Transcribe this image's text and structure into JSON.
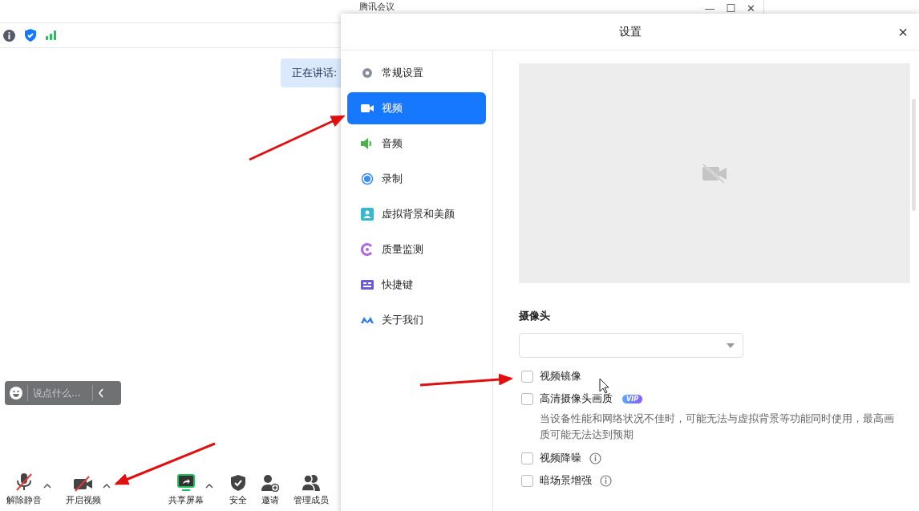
{
  "main_window": {
    "title": "腾讯会议",
    "window_controls": [
      "—",
      "☐",
      "✕"
    ],
    "speaking_label": "正在讲话:",
    "chat": {
      "placeholder": "说点什么..."
    },
    "toolbar": [
      {
        "kind": "mic",
        "label": "解除静音",
        "caret": true
      },
      {
        "kind": "camera",
        "label": "开启视频",
        "caret": true
      },
      {
        "kind": "share",
        "label": "共享屏幕",
        "caret": true
      },
      {
        "kind": "shield",
        "label": "安全",
        "caret": false
      },
      {
        "kind": "invite",
        "label": "邀请",
        "caret": false
      },
      {
        "kind": "members",
        "label": "管理成员",
        "caret": false
      }
    ]
  },
  "settings_dialog": {
    "title": "设置",
    "close": "×",
    "sidebar": [
      {
        "kind": "gear",
        "label": "常规设置",
        "selected": false
      },
      {
        "kind": "video",
        "label": "视频",
        "selected": true
      },
      {
        "kind": "audio",
        "label": "音频",
        "selected": false
      },
      {
        "kind": "record",
        "label": "录制",
        "selected": false
      },
      {
        "kind": "background",
        "label": "虚拟背景和美颜",
        "selected": false
      },
      {
        "kind": "quality",
        "label": "质量监测",
        "selected": false
      },
      {
        "kind": "keyboard",
        "label": "快捷键",
        "selected": false
      },
      {
        "kind": "about",
        "label": "关于我们",
        "selected": false
      }
    ],
    "camera_label": "摄像头",
    "options": [
      {
        "label": "视频镜像",
        "checked": false
      },
      {
        "label": "高清摄像头画质",
        "checked": false,
        "badge": "VIP",
        "description": "当设备性能和网络状况不佳时，可能无法与虚拟背景等功能同时使用，最高画质可能无法达到预期"
      },
      {
        "label": "视频降噪",
        "checked": false,
        "info": true
      },
      {
        "label": "暗场景增强",
        "checked": false,
        "info": true
      }
    ]
  }
}
